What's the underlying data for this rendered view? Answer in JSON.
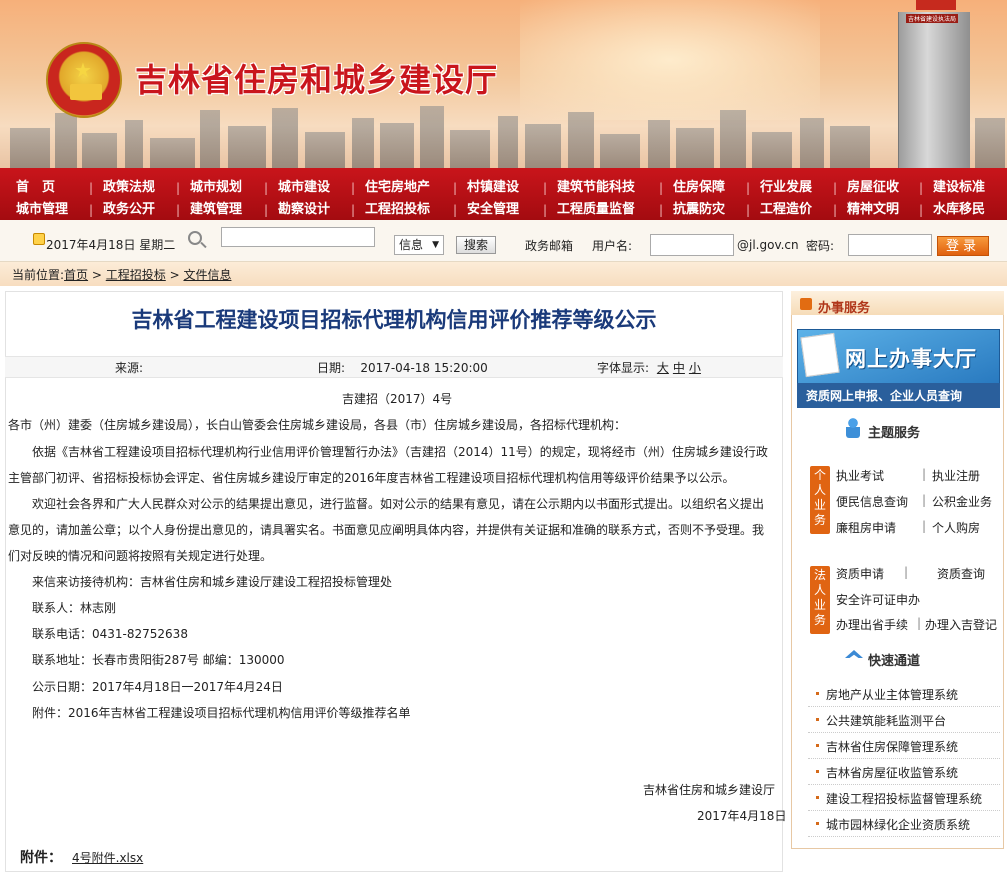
{
  "site": {
    "title": "吉林省住房和城乡建设厅",
    "tower_sign": "建设大厦",
    "tower_sign2": "吉林省建设执法局"
  },
  "nav": {
    "row1": [
      "首　页",
      "政策法规",
      "城市规划",
      "城市建设",
      "住宅房地产",
      "村镇建设",
      "建筑节能科技",
      "住房保障",
      "行业发展",
      "房屋征收",
      "建设标准"
    ],
    "row2": [
      "城市管理",
      "政务公开",
      "建筑管理",
      "勘察设计",
      "工程招投标",
      "安全管理",
      "工程质量监督",
      "抗震防灾",
      "工程造价",
      "精神文明",
      "水库移民"
    ]
  },
  "toolbar": {
    "date": "2017年4月18日  星期二",
    "search_placeholder": "",
    "select_value": "信息",
    "search_btn": "搜索",
    "mail_label": "政务邮箱",
    "user_label": "用户名:",
    "domain": "@jl.gov.cn",
    "password_label": "密码:",
    "login_btn": "登录"
  },
  "breadcrumb": {
    "prefix": "当前位置:",
    "home": "首页",
    "sep": " > ",
    "section": "工程招投标",
    "page": "文件信息"
  },
  "article": {
    "title": "吉林省工程建设项目招标代理机构信用评价推荐等级公示",
    "source_label": "来源:",
    "date_label": "日期:",
    "date_value": "2017-04-18 15:20:00",
    "font_label": "字体显示:",
    "font_sizes": [
      "大",
      "中",
      "小"
    ],
    "doc_no": "吉建招（2017）4号",
    "lines": [
      "各市（州）建委（住房城乡建设局），长白山管委会住房城乡建设局，各县（市）住房城乡建设局，各招标代理机构：",
      "依据《吉林省工程建设项目招标代理机构行业信用评价管理暂行办法》（吉建招（2014）11号）的规定，现将经市（州）住房城乡建设行政",
      "主管部门初评、省招标投标协会评定、省住房城乡建设厅审定的2016年度吉林省工程建设项目招标代理机构信用等级评价结果予以公示。",
      "欢迎社会各界和广大人民群众对公示的结果提出意见，进行监督。如对公示的结果有意见，请在公示期内以书面形式提出。以组织名义提出",
      "意见的，请加盖公章；以个人身份提出意见的，请具署实名。书面意见应阐明具体内容，并提供有关证据和准确的联系方式，否则不予受理。我",
      "们对反映的情况和问题将按照有关规定进行处理。",
      "来信来访接待机构：吉林省住房和城乡建设厅建设工程招投标管理处",
      "联系人：林志刚",
      "联系电话：0431-82752638",
      "联系地址：长春市贵阳街287号  邮编：130000",
      "公示日期：2017年4月18日一2017年4月24日",
      "附件：2016年吉林省工程建设项目招标代理机构信用评价等级推荐名单"
    ],
    "signature": "吉林省住房和城乡建设厅",
    "sign_date": "2017年4月18日",
    "attachment_label": "附件：",
    "attachment_file": "4号附件.xlsx"
  },
  "sidebar": {
    "header": "办事服务",
    "hall_title": "网上办事大厅",
    "hall_sub": "资质网上申报、企业人员查询",
    "theme_title": "主题服务",
    "personal_tag": "个人业务",
    "personal_items": [
      "执业考试",
      "执业注册",
      "便民信息查询",
      "公积金业务",
      "廉租房申请",
      "个人购房"
    ],
    "legal_tag": "法人业务",
    "legal_items": [
      "资质申请",
      "资质查询",
      "安全许可证申办",
      "办理出省手续",
      "办理入吉登记"
    ],
    "fast_title": "快速通道",
    "fast_items": [
      "房地产从业主体管理系统",
      "公共建筑能耗监测平台",
      "吉林省住房保障管理系统",
      "吉林省房屋征收监管系统",
      "建设工程招投标监督管理系统",
      "城市园林绿化企业资质系统"
    ]
  }
}
